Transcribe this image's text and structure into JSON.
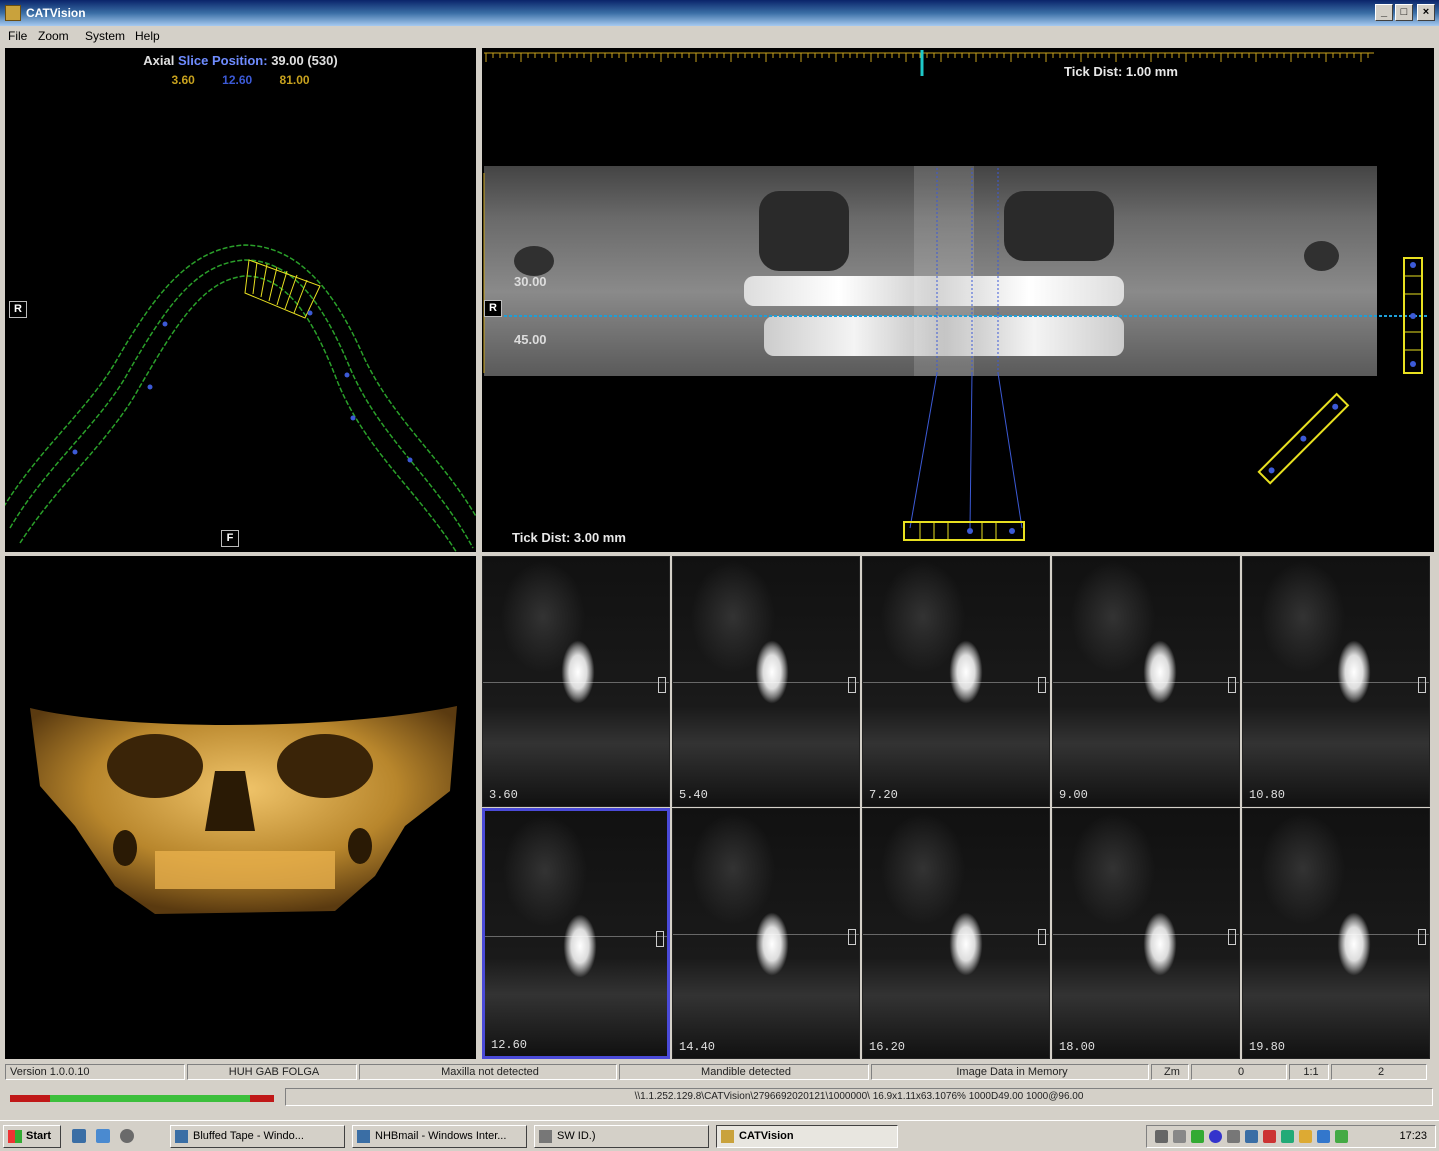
{
  "window": {
    "title": "CATVision"
  },
  "menu": {
    "items": [
      "File",
      "Zoom",
      "System",
      "Help"
    ]
  },
  "axial": {
    "title_prefix": "Axial",
    "title_highlight": "Slice Position:",
    "title_value": "39.00 (530)",
    "values": [
      "3.60",
      "12.60",
      "81.00"
    ],
    "value_colors": [
      "#c8a21e",
      "#3c5ad6",
      "#c8a21e"
    ],
    "orient_right": "R",
    "orient_front": "F"
  },
  "pano": {
    "tick_dist_top": "Tick Dist: 1.00 mm",
    "tick_dist_bottom": "Tick Dist: 3.00 mm",
    "depth_upper": "30.00",
    "depth_lower": "45.00",
    "orient_right": "R"
  },
  "cross_sections": {
    "labels": [
      "3.60",
      "5.40",
      "7.20",
      "9.00",
      "10.80",
      "12.60",
      "14.40",
      "16.20",
      "18.00",
      "19.80"
    ],
    "selected_index": 5
  },
  "status": {
    "version": "Version 1.0.0.10",
    "host": "HUH GAB FOLGA",
    "maxilla": "Maxilla not detected",
    "mandible": "Mandible detected",
    "memory": "Image Data in Memory",
    "zoom_label": "Zm",
    "zoom_value": "0",
    "ratio_label": "1:1",
    "ratio_value": "2"
  },
  "path_text": "\\\\1.1.252.129.8\\CATVision\\2796692020121\\1000000\\ 16.9x1.11x63.1076% 1000D49.00 1000@96.00",
  "taskbar": {
    "start": "Start",
    "tasks": [
      "Bluffed Tape - Windo...",
      "NHBmail - Windows Inter...",
      "SW ID.)",
      "CATVision"
    ],
    "clock": "17:23"
  },
  "colors": {
    "accent_blue": "#3c5ad6",
    "guide_yellow": "#e8e020",
    "curve_green": "#2aa02a",
    "slice_cyan": "#1e9fd8",
    "progress_green": "#3cbf3c",
    "progress_red": "#c01818"
  }
}
